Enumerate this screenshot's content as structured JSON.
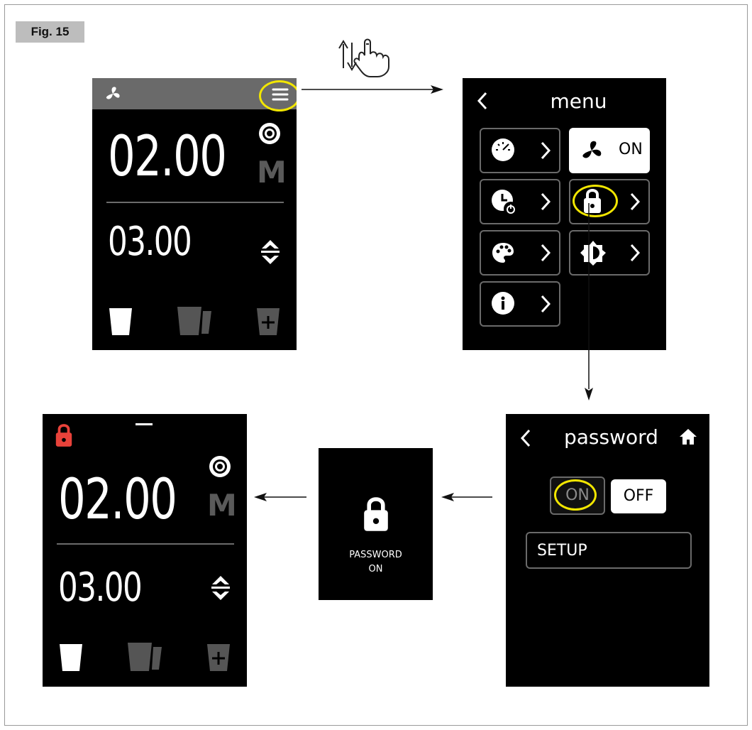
{
  "figure": {
    "label": "Fig. 15"
  },
  "home_screen": {
    "main_value": "02.00",
    "secondary_value": "03.00",
    "mode_letter": "M"
  },
  "menu_screen": {
    "title": "menu",
    "fan_toggle_label": "ON"
  },
  "password_screen": {
    "title": "password",
    "on_label": "ON",
    "off_label": "OFF",
    "setup_label": "SETUP"
  },
  "confirm_screen": {
    "line1": "PASSWORD",
    "line2": "ON"
  },
  "locked_screen": {
    "main_value": "02.00",
    "secondary_value": "03.00",
    "mode_letter": "M"
  },
  "colors": {
    "highlight": "#f2e600",
    "lock_red": "#e8423a",
    "header_gray": "#6a6a6a",
    "inactive_gray": "#5a5a5a"
  }
}
